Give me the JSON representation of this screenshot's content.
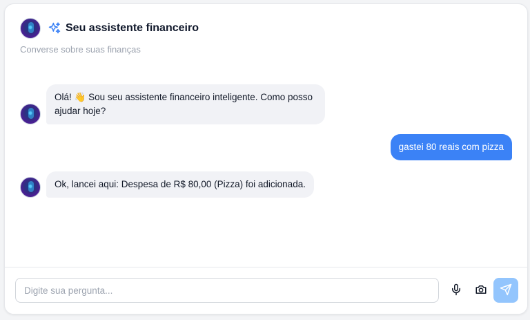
{
  "header": {
    "title": "Seu assistente financeiro",
    "subtitle": "Converse sobre suas finanças"
  },
  "messages": [
    {
      "sender": "assistant",
      "text": "Olá! 👋 Sou seu assistente financeiro inteligente. Como posso ajudar hoje?"
    },
    {
      "sender": "user",
      "text": "gastei 80 reais com pizza"
    },
    {
      "sender": "assistant",
      "text": "Ok, lancei aqui: Despesa de R$ 80,00 (Pizza) foi adicionada."
    }
  ],
  "composer": {
    "placeholder": "Digite sua pergunta..."
  },
  "icons": {
    "header_icon": "sparkles-icon",
    "mic": "microphone-icon",
    "camera": "camera-icon",
    "send": "send-icon"
  },
  "colors": {
    "user_bubble": "#3b82f6",
    "assistant_bubble": "#f1f2f6",
    "send_button": "#93c5fd",
    "sparkle": "#3b82f6"
  }
}
